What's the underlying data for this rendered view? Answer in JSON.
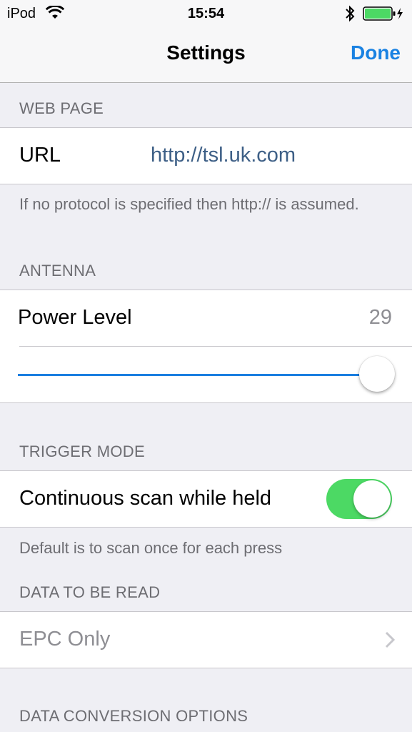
{
  "status_bar": {
    "carrier": "iPod",
    "time": "15:54",
    "icons": [
      "wifi-icon",
      "bluetooth-icon",
      "battery-charging-icon"
    ],
    "battery_color": "#4cd964"
  },
  "nav": {
    "title": "Settings",
    "done_label": "Done",
    "accent_color": "#1a82e2"
  },
  "web_page": {
    "header": "WEB PAGE",
    "url_label": "URL",
    "url_value": "http://tsl.uk.com",
    "footer": "If no protocol is specified then http:// is assumed."
  },
  "antenna": {
    "header": "ANTENNA",
    "power_label": "Power Level",
    "power_value": "29",
    "slider_fraction": 1.0
  },
  "trigger_mode": {
    "header": "TRIGGER MODE",
    "toggle_label": "Continuous scan while held",
    "toggle_on": true,
    "footer": "Default is to scan once for each press"
  },
  "data_to_be_read": {
    "header": "DATA TO BE READ",
    "selected_value": "EPC Only"
  },
  "data_conversion": {
    "header": "DATA CONVERSION OPTIONS"
  }
}
